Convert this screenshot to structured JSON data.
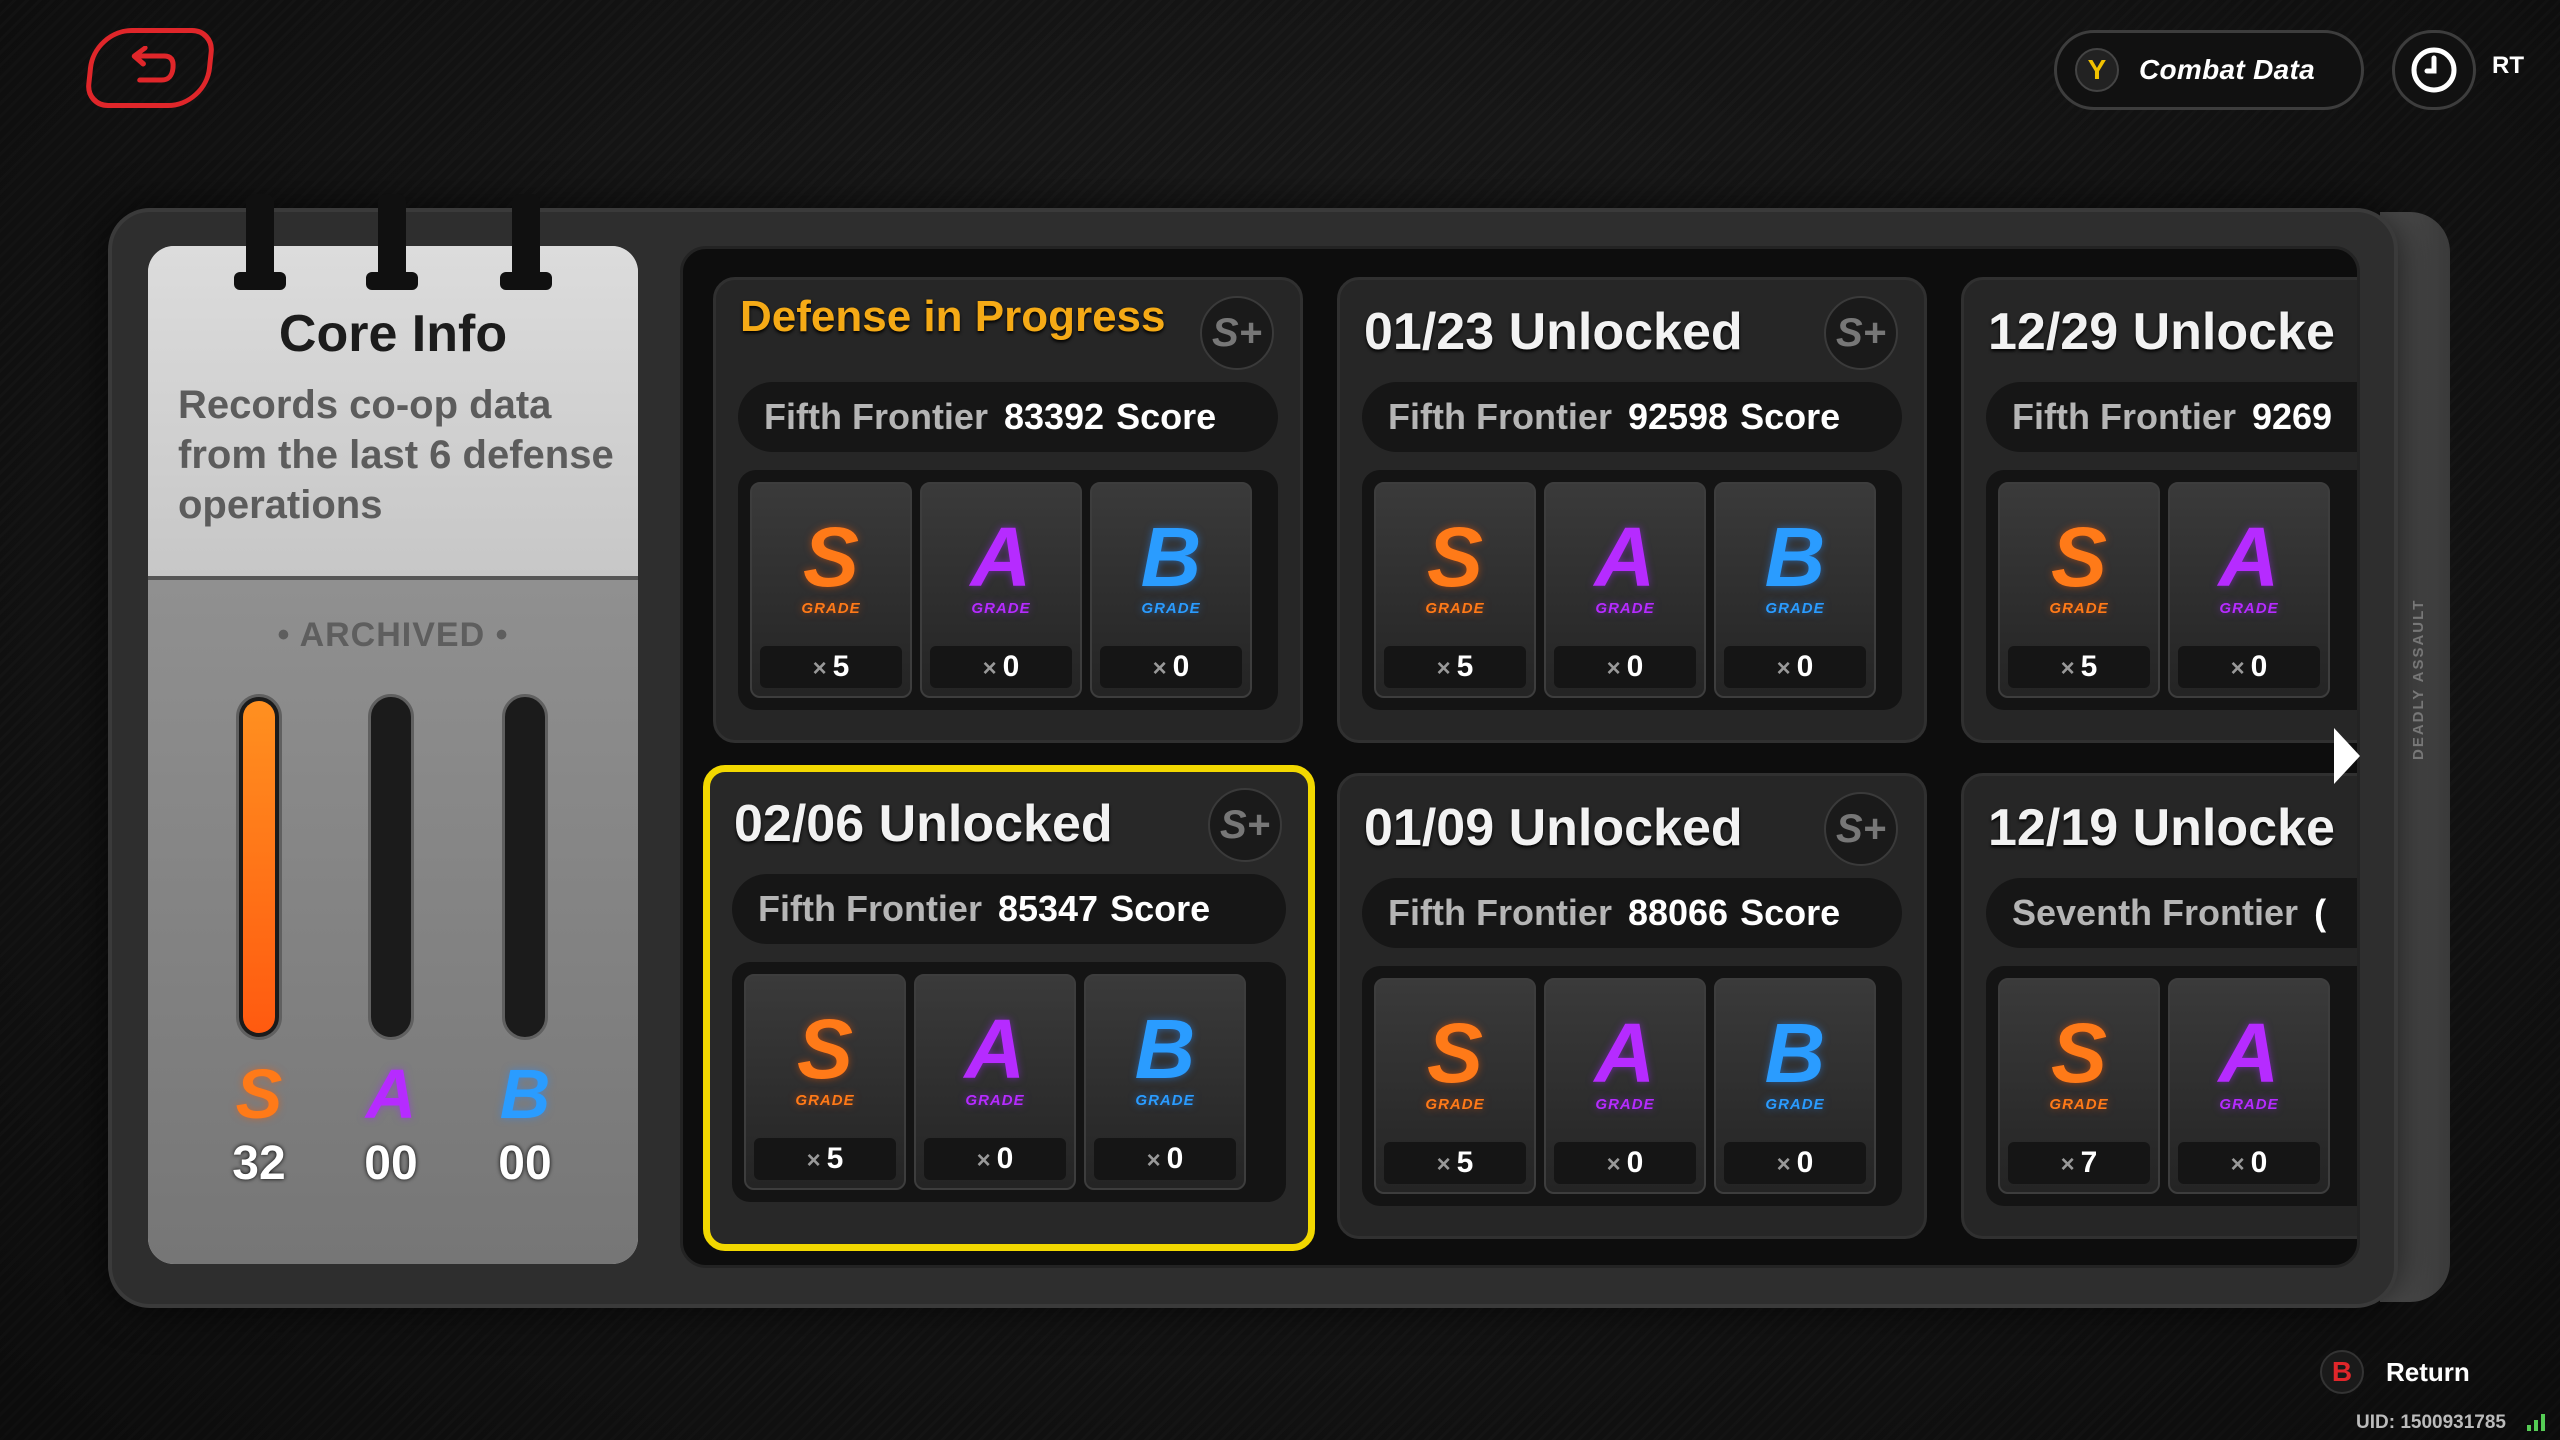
{
  "topbar": {
    "back_icon": "return-arrow-icon",
    "combat_button_key": "Y",
    "combat_button_label": "Combat Data",
    "timer_icon": "clock-icon",
    "rt_label": "RT"
  },
  "core_info": {
    "title": "Core Info",
    "description": "Records co-op data from the last 6 defense operations",
    "archived_label": "ARCHIVED",
    "bars": [
      {
        "grade": "S",
        "count": "32",
        "fill": 1.0
      },
      {
        "grade": "A",
        "count": "00",
        "fill": 0
      },
      {
        "grade": "B",
        "count": "00",
        "fill": 0
      }
    ]
  },
  "records": [
    {
      "title": "Defense in Progress",
      "in_progress": true,
      "frontier": "Fifth Frontier",
      "score": "83392",
      "unit": "Score",
      "badge": "S+",
      "grades": [
        {
          "g": "S",
          "count": "5"
        },
        {
          "g": "A",
          "count": "0"
        },
        {
          "g": "B",
          "count": "0"
        }
      ]
    },
    {
      "title": "01/23 Unlocked",
      "in_progress": false,
      "frontier": "Fifth Frontier",
      "score": "92598",
      "unit": "Score",
      "badge": "S+",
      "grades": [
        {
          "g": "S",
          "count": "5"
        },
        {
          "g": "A",
          "count": "0"
        },
        {
          "g": "B",
          "count": "0"
        }
      ]
    },
    {
      "title": "12/29 Unlocke",
      "in_progress": false,
      "frontier": "Fifth Frontier",
      "score": "9269",
      "unit": "",
      "badge": "",
      "grades": [
        {
          "g": "S",
          "count": "5"
        },
        {
          "g": "A",
          "count": "0"
        }
      ]
    },
    {
      "title": "02/06 Unlocked",
      "in_progress": false,
      "selected": true,
      "frontier": "Fifth Frontier",
      "score": "85347",
      "unit": "Score",
      "badge": "S+",
      "grades": [
        {
          "g": "S",
          "count": "5"
        },
        {
          "g": "A",
          "count": "0"
        },
        {
          "g": "B",
          "count": "0"
        }
      ]
    },
    {
      "title": "01/09 Unlocked",
      "in_progress": false,
      "frontier": "Fifth Frontier",
      "score": "88066",
      "unit": "Score",
      "badge": "S+",
      "grades": [
        {
          "g": "S",
          "count": "5"
        },
        {
          "g": "A",
          "count": "0"
        },
        {
          "g": "B",
          "count": "0"
        }
      ]
    },
    {
      "title": "12/19 Unlocke",
      "in_progress": false,
      "frontier": "Seventh Frontier",
      "score": "(",
      "unit": "",
      "badge": "",
      "grades": [
        {
          "g": "S",
          "count": "7"
        },
        {
          "g": "A",
          "count": "0"
        }
      ]
    }
  ],
  "grade_sub_label": "GRADE",
  "count_prefix": "×",
  "side_label": "DEADLY ASSAULT",
  "footer": {
    "return_key": "B",
    "return_label": "Return",
    "uid": "UID: 1500931785"
  },
  "colors": {
    "accent_yellow": "#f2d800",
    "in_progress_orange": "#f5aa16",
    "grade_s": "#ff7a18",
    "grade_a": "#b62bff",
    "grade_b": "#2a9cff",
    "back_red": "#e0262a"
  }
}
